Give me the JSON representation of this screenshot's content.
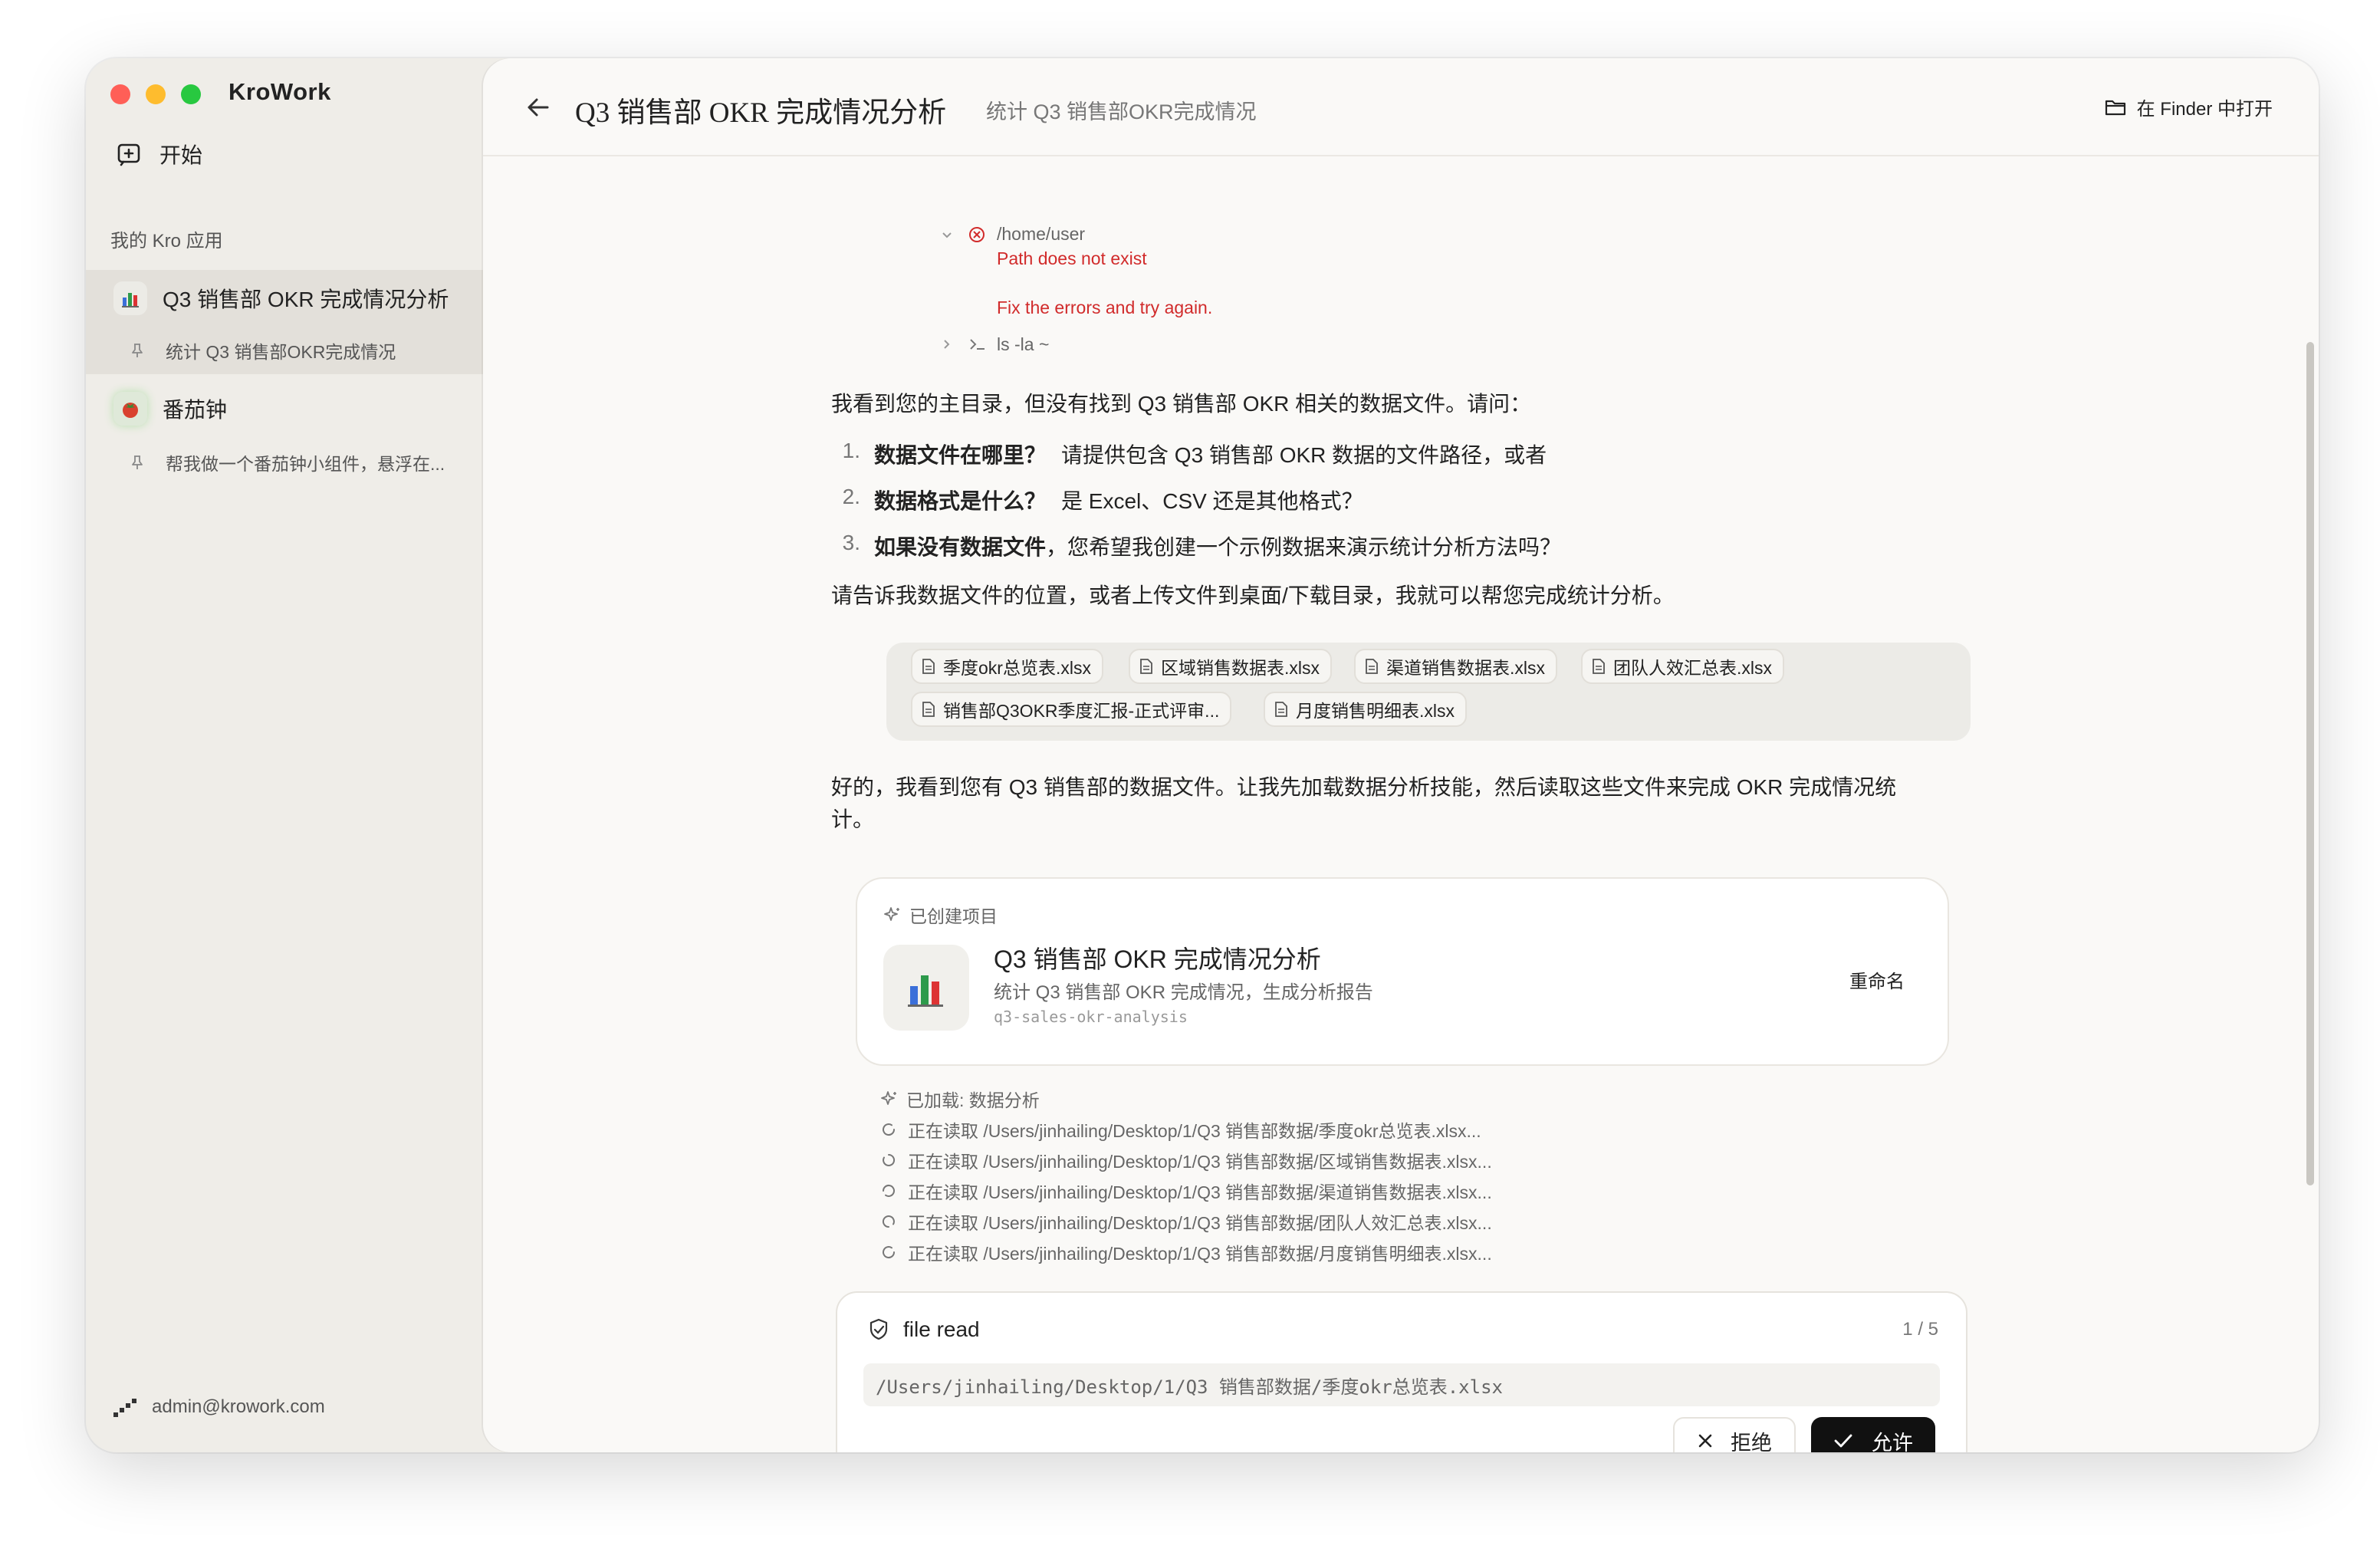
{
  "window": {
    "app_name": "KroWork",
    "traffic_colors": [
      "#ff5f57",
      "#febc2e",
      "#28c840"
    ]
  },
  "sidebar": {
    "start_label": "开始",
    "section_title": "我的 Kro 应用",
    "apps": [
      {
        "label": "Q3 销售部 OKR 完成情况分析",
        "icon": "bar-chart-icon",
        "sub": "统计 Q3 销售部OKR完成情况"
      },
      {
        "label": "番茄钟",
        "icon": "tomato-icon",
        "sub": "帮我做一个番茄钟小组件，悬浮在..."
      }
    ],
    "user_email": "admin@krowork.com"
  },
  "header": {
    "title": "Q3 销售部 OKR 完成情况分析",
    "subtitle": "统计 Q3 销售部OKR完成情况",
    "finder_label": "在 Finder 中打开"
  },
  "log": {
    "path": "/home/user",
    "error": "Path does not exist",
    "fix": "Fix the errors and try again.",
    "command": "ls -la ~"
  },
  "messages": {
    "intro": "我看到您的主目录，但没有找到 Q3 销售部 OKR 相关的数据文件。请问：",
    "questions": [
      {
        "num": "1.",
        "bold": "数据文件在哪里？",
        "text": "请提供包含 Q3 销售部 OKR 数据的文件路径，或者"
      },
      {
        "num": "2.",
        "bold": "数据格式是什么？",
        "text": "是 Excel、CSV 还是其他格式？"
      },
      {
        "num": "3.",
        "bold": "如果没有数据文件",
        "text": "，您希望我创建一个示例数据来演示统计分析方法吗？"
      }
    ],
    "outro": "请告诉我数据文件的位置，或者上传文件到桌面/下载目录，我就可以帮您完成统计分析。",
    "files": [
      "季度okr总览表.xlsx",
      "区域销售数据表.xlsx",
      "渠道销售数据表.xlsx",
      "团队人效汇总表.xlsx",
      "销售部Q3OKR季度汇报-正式评审...",
      "月度销售明细表.xlsx"
    ],
    "reply_line1": "好的，我看到您有 Q3 销售部的数据文件。让我先加载数据分析技能，然后读取这些文件来完成 OKR 完成情况统",
    "reply_line2": "计。"
  },
  "project_card": {
    "label": "已创建项目",
    "title": "Q3 销售部 OKR 完成情况分析",
    "desc": "统计 Q3 销售部 OKR 完成情况，生成分析报告",
    "slug": "q3-sales-okr-analysis",
    "rename": "重命名"
  },
  "skill": {
    "loaded": "已加载: 数据分析",
    "reads": [
      "正在读取 /Users/jinhailing/Desktop/1/Q3 销售部数据/季度okr总览表.xlsx...",
      "正在读取 /Users/jinhailing/Desktop/1/Q3 销售部数据/区域销售数据表.xlsx...",
      "正在读取 /Users/jinhailing/Desktop/1/Q3 销售部数据/渠道销售数据表.xlsx...",
      "正在读取 /Users/jinhailing/Desktop/1/Q3 销售部数据/团队人效汇总表.xlsx...",
      "正在读取 /Users/jinhailing/Desktop/1/Q3 销售部数据/月度销售明细表.xlsx..."
    ]
  },
  "permission": {
    "title": "file read",
    "counter": "1 / 5",
    "path": "/Users/jinhailing/Desktop/1/Q3 销售部数据/季度okr总览表.xlsx",
    "deny": "拒绝",
    "allow": "允许"
  }
}
